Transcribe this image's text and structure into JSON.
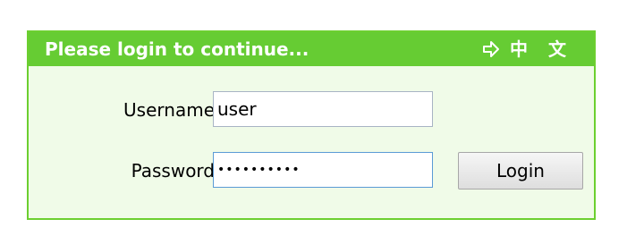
{
  "login_panel": {
    "title": "Please login to continue...",
    "language_switch": {
      "icon": "arrow-right-icon",
      "label": "中 文"
    },
    "username": {
      "label": "Username",
      "value": "user"
    },
    "password": {
      "label": "Password",
      "value": "••••••••••"
    },
    "login_button_label": "Login"
  },
  "colors": {
    "header_green": "#66cc33",
    "border_green": "#6ccf30",
    "panel_background": "#f0fbe8"
  }
}
